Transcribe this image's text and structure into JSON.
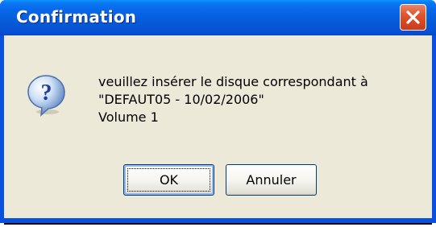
{
  "window": {
    "title": "Confirmation",
    "close_icon": "close-x-icon"
  },
  "message": {
    "icon": "question-icon",
    "lines": [
      "veuillez insérer le disque correspondant à",
      "\"DEFAUT05 - 10/02/2006\"",
      "Volume 1"
    ]
  },
  "buttons": {
    "ok_label": "OK",
    "cancel_label": "Annuler"
  },
  "colors": {
    "titlebar": "#0558d6",
    "client_background": "#ece9d8",
    "close_button": "#e0542f"
  }
}
